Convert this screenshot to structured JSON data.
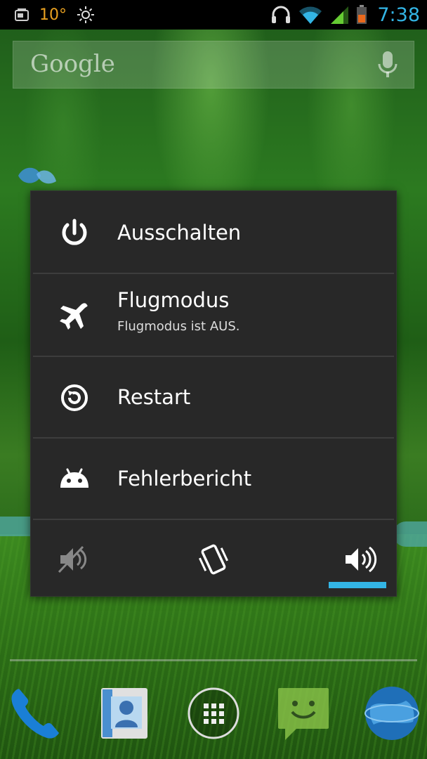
{
  "status_bar": {
    "temperature": "10°",
    "time": "7:38",
    "icons": [
      "sim-icon",
      "brightness-icon",
      "headset-icon",
      "wifi-icon",
      "signal-icon",
      "battery-icon"
    ]
  },
  "search": {
    "label": "Google",
    "icon": "microphone-icon"
  },
  "power_menu": {
    "items": [
      {
        "label": "Ausschalten",
        "icon": "power-icon"
      },
      {
        "label": "Flugmodus",
        "sublabel": "Flugmodus ist AUS.",
        "icon": "airplane-icon"
      },
      {
        "label": "Restart",
        "icon": "restart-icon"
      },
      {
        "label": "Fehlerbericht",
        "icon": "android-icon"
      }
    ],
    "sound_modes": [
      {
        "name": "silent",
        "icon": "mute-icon",
        "selected": false
      },
      {
        "name": "vibrate",
        "icon": "vibrate-icon",
        "selected": false
      },
      {
        "name": "sound",
        "icon": "speaker-icon",
        "selected": true
      }
    ],
    "accent_color": "#33b5e5"
  },
  "dock": {
    "items": [
      "phone-icon",
      "contacts-icon",
      "app-drawer-icon",
      "messaging-icon",
      "browser-icon"
    ]
  }
}
